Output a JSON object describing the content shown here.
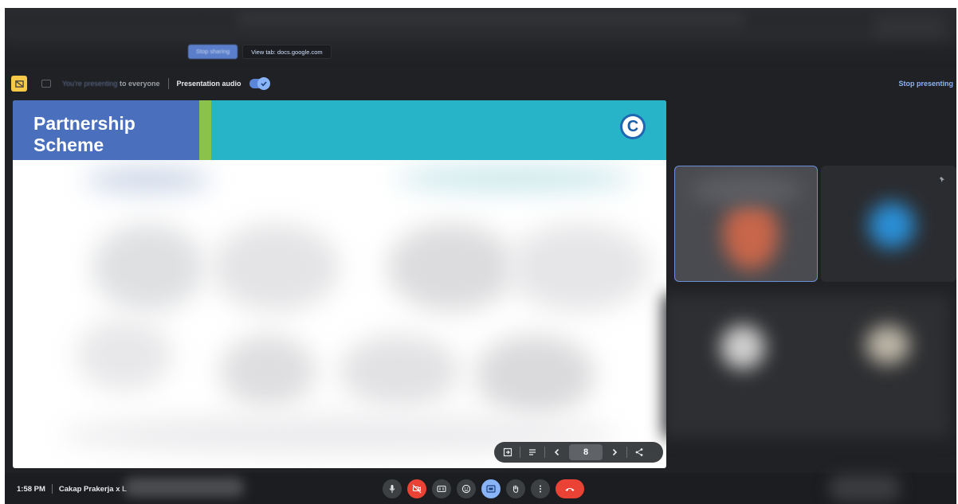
{
  "share_bar": {
    "stop_sharing_label": "Stop sharing",
    "view_tab_label": "View tab: docs.google.com"
  },
  "presenting_bar": {
    "status_faded": "You're presenting",
    "status_text": "to everyone",
    "audio_label": "Presentation audio",
    "audio_enabled": true,
    "stop_label": "Stop presenting"
  },
  "slide": {
    "title_line1": "Partnership",
    "title_line2": "Scheme",
    "logo_letter": "C",
    "header_color": "#28b4c8",
    "title_box_color": "#4a6fbd",
    "accent_color": "#8bc34a"
  },
  "slide_controls": {
    "current_page": "8"
  },
  "bottom_bar": {
    "time": "1:58 PM",
    "meeting_name": "Cakap Prakerja x L"
  },
  "colors": {
    "danger": "#ea4335",
    "accent_blue": "#8ab4f8"
  }
}
